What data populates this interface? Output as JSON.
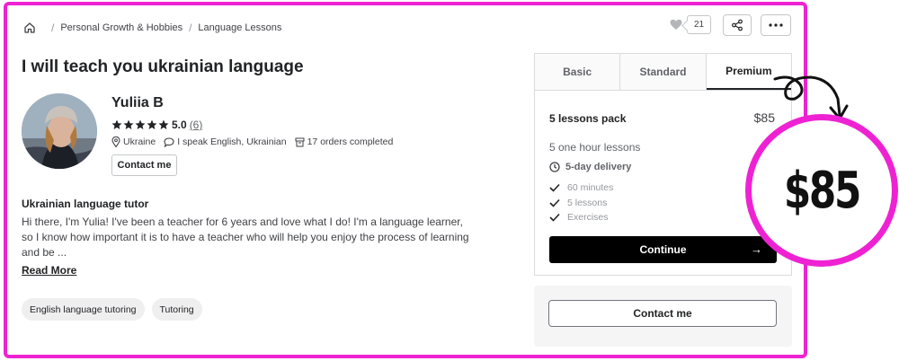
{
  "breadcrumb": {
    "items": [
      "Personal Growth & Hobbies",
      "Language Lessons"
    ]
  },
  "actions": {
    "likes_count": "21"
  },
  "gig": {
    "title": "I will teach you ukrainian language"
  },
  "seller": {
    "name": "Yuliia B",
    "rating": "5.0",
    "rating_count": "(6)",
    "country": "Ukraine",
    "languages": "I speak English, Ukrainian",
    "orders": "17 orders completed",
    "contact_label": "Contact me"
  },
  "about": {
    "title": "Ukrainian language tutor",
    "text": "Hi there, I'm Yulia! I've been a teacher for 6 years and love what I do! I'm a language learner, so I know how important it is to have a teacher who will help you enjoy the process of learning and be ...",
    "read_more": "Read More"
  },
  "tags": [
    "English language tutoring",
    "Tutoring"
  ],
  "package": {
    "tabs": [
      "Basic",
      "Standard",
      "Premium"
    ],
    "active_tab": "Premium",
    "name": "5 lessons pack",
    "price": "$85",
    "description": "5 one hour lessons",
    "delivery": "5-day delivery",
    "features": [
      "60 minutes",
      "5 lessons",
      "Exercises"
    ],
    "continue_label": "Continue"
  },
  "contact_panel": {
    "label": "Contact me"
  },
  "overlay": {
    "price": "$85"
  },
  "colors": {
    "accent_border": "#ee22d3",
    "star": "#222325",
    "button_dark": "#000000"
  }
}
